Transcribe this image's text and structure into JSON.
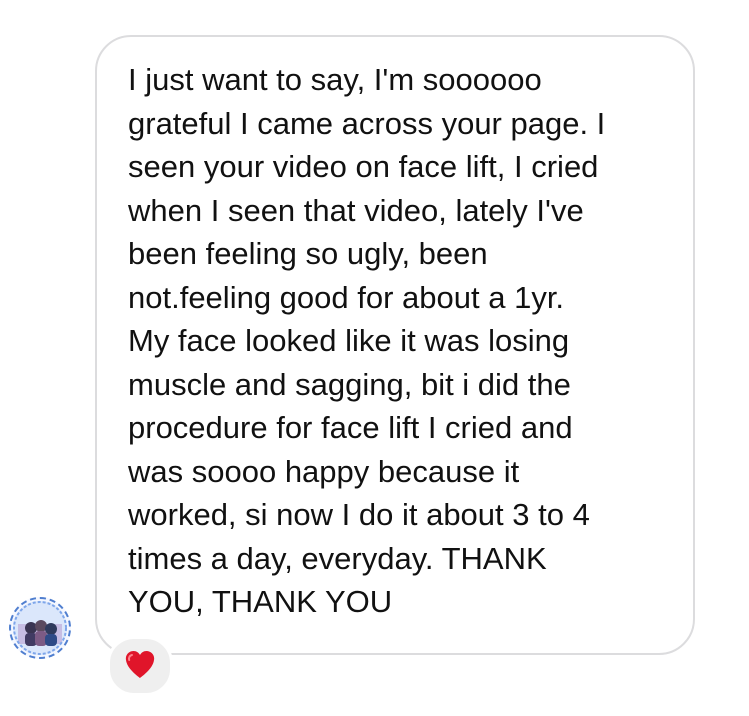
{
  "message": {
    "text": "I just want to say, I'm soooooo\ngrateful I came across your page. I\nseen your video on face lift, I cried\nwhen I seen that video, lately I've\nbeen feeling so ugly, been\nnot.feeling good for about a 1yr.\nMy face looked like it was losing\nmuscle and sagging, bit i did the\nprocedure for face lift I cried and\nwas soooo happy because it\nworked, si now I do it about 3 to 4\ntimes a day, everyday. THANK\nYOU, THANK YOU"
  },
  "reaction": {
    "icon": "heart-icon",
    "color": "#e0152a"
  },
  "colors": {
    "bubble_border": "#dcdcde",
    "text": "#111111",
    "reaction_background": "#efefef",
    "avatar_ring": "#4f7ecf"
  }
}
